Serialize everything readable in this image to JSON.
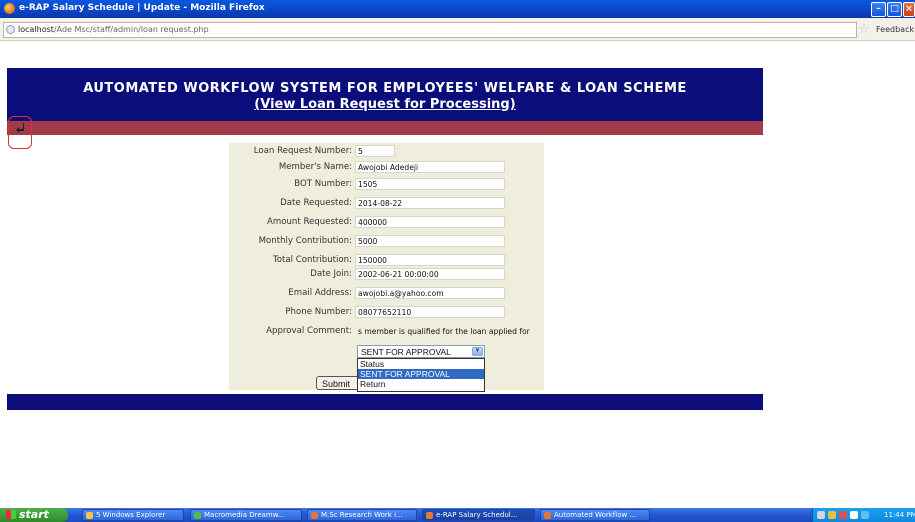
{
  "window": {
    "title": "e-RAP Salary Schedule | Update - Mozilla Firefox",
    "min": "–",
    "max": "□",
    "close": "×"
  },
  "urlbar": {
    "host": "localhost",
    "path": "/Ade Msc/staff/admin/loan request.php",
    "feedback": "Feedback",
    "icons": {
      "site": "globe-icon",
      "bookmark": "star-icon"
    }
  },
  "banner": {
    "title": "AUTOMATED WORKFLOW SYSTEM FOR EMPLOYEES' WELFARE & LOAN SCHEME",
    "subtitle": "(View Loan Request for Processing)",
    "back_icon": "back-arrow-icon"
  },
  "form": {
    "loan_request_number": {
      "label": "Loan Request Number:",
      "value": "5"
    },
    "members_name": {
      "label": "Member's Name:",
      "value": "Awojobi Adedeji"
    },
    "bot_number": {
      "label": "BOT Number:",
      "value": "1505"
    },
    "date_requested": {
      "label": "Date Requested:",
      "value": "2014-08-22"
    },
    "amount_requested": {
      "label": "Amount Requested:",
      "value": "400000"
    },
    "monthly_contribution": {
      "label": "Monthly Contribution:",
      "value": "5000"
    },
    "total_contribution": {
      "label": "Total Contribution:",
      "value": "150000"
    },
    "date_join": {
      "label": "Date Join:",
      "value": "2002-06-21 00:00:00"
    },
    "email_address": {
      "label": "Email Address:",
      "value": "awojobi.a@yahoo.com"
    },
    "phone_number": {
      "label": "Phone Number:",
      "value": "08077652110"
    },
    "approval_comment": {
      "label": "Approval Comment:",
      "value": "s member is qualified for the loan applied for"
    },
    "status_select": {
      "selected": "SENT FOR APPROVAL",
      "options": [
        "Status",
        "SENT FOR APPROVAL",
        "Return"
      ]
    },
    "submit_label": "Submit"
  },
  "taskbar": {
    "start_label": "start",
    "tasks": [
      {
        "label": "5 Windows Explorer"
      },
      {
        "label": "Macromedia Dreamw..."
      },
      {
        "label": "M.Sc Research Work i..."
      },
      {
        "label": "e-RAP Salary Schedul..."
      },
      {
        "label": "Automated Workflow ..."
      }
    ],
    "clock": "11:44 PM"
  },
  "colors": {
    "banner": "#0b0e7a",
    "banner_stripe": "#a33a48",
    "form_panel": "#efeedd",
    "selection": "#316ac5"
  }
}
